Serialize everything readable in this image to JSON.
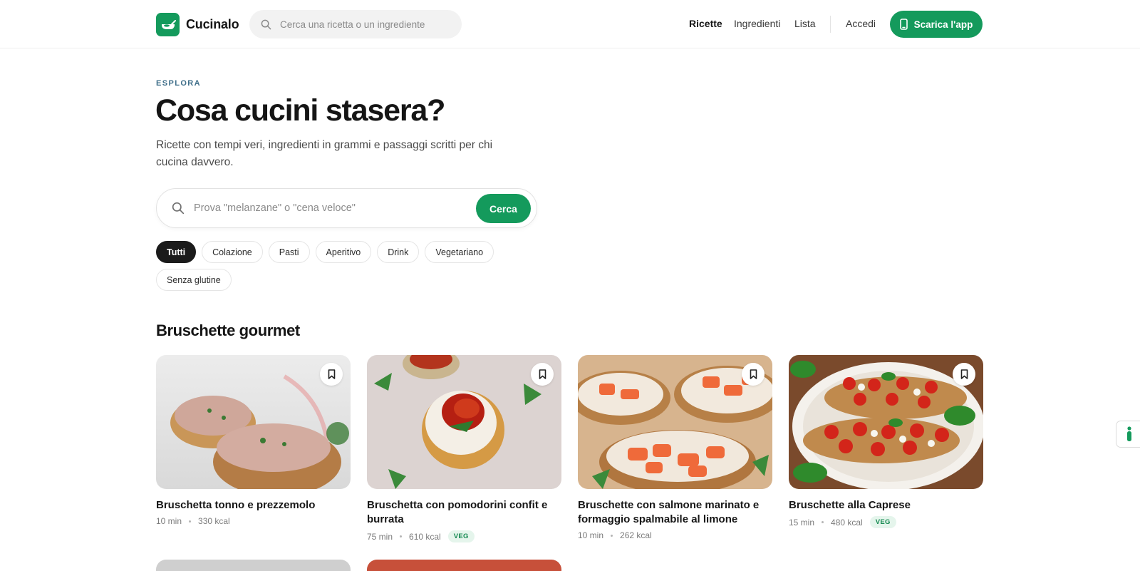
{
  "brand": {
    "name": "Cucinalo",
    "accent": "#149a5c"
  },
  "header": {
    "search_placeholder": "Cerca una ricetta o un ingrediente",
    "nav": [
      {
        "label": "Ricette",
        "active": true
      },
      {
        "label": "Ingredienti"
      },
      {
        "label": "Lista"
      }
    ],
    "login": "Accedi",
    "cta": "Scarica l'app"
  },
  "hero": {
    "eyebrow": "ESPLORA",
    "title": "Cosa cucini stasera?",
    "subtitle": "Ricette con tempi veri, ingredienti in grammi e passaggi scritti per chi cucina davvero.",
    "search_placeholder": "Prova \"melanzane\" o \"cena veloce\"",
    "search_button": "Cerca"
  },
  "filters": [
    {
      "label": "Tutti",
      "active": true
    },
    {
      "label": "Colazione"
    },
    {
      "label": "Pasti"
    },
    {
      "label": "Aperitivo"
    },
    {
      "label": "Drink"
    },
    {
      "label": "Vegetariano"
    },
    {
      "label": "Senza glutine"
    }
  ],
  "section": {
    "title": "Bruschette gourmet",
    "recipes": [
      {
        "title": "Bruschetta tonno e prezzemolo",
        "time": "10 min",
        "kcal": "330 kcal",
        "veg": false
      },
      {
        "title": "Bruschetta con pomodorini confit e burrata",
        "time": "75 min",
        "kcal": "610 kcal",
        "veg": true,
        "badge": "VEG"
      },
      {
        "title": "Bruschette con salmone marinato e formaggio spalmabile al limone",
        "time": "10 min",
        "kcal": "262 kcal",
        "veg": false
      },
      {
        "title": "Bruschette alla Caprese",
        "time": "15 min",
        "kcal": "480 kcal",
        "veg": true,
        "badge": "VEG"
      }
    ]
  }
}
